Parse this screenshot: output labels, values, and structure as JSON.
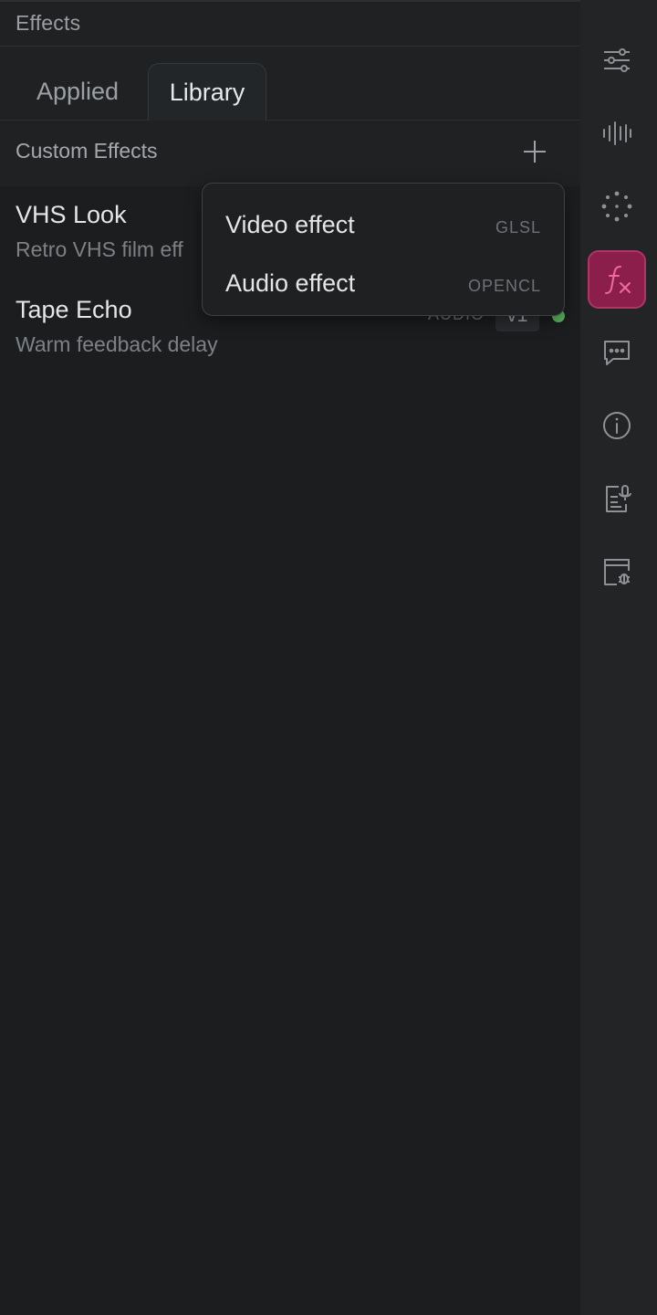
{
  "panel": {
    "title": "Effects"
  },
  "tabs": [
    {
      "label": "Applied",
      "active": false
    },
    {
      "label": "Library",
      "active": true
    }
  ],
  "section": {
    "title": "Custom Effects",
    "add_icon": "plus-icon"
  },
  "effects": [
    {
      "name": "VHS Look",
      "description": "Retro VHS film eff",
      "kind": "",
      "version": "",
      "status_color": ""
    },
    {
      "name": "Tape Echo",
      "description": "Warm feedback delay",
      "kind": "AUDIO",
      "version": "v1",
      "status_color": "#5cb860"
    }
  ],
  "dropdown": {
    "items": [
      {
        "label": "Video effect",
        "hint": "GLSL"
      },
      {
        "label": "Audio effect",
        "hint": "OPENCL"
      }
    ]
  },
  "rail": {
    "items": [
      {
        "icon": "sliders-icon",
        "active": false
      },
      {
        "icon": "waveform-icon",
        "active": false
      },
      {
        "icon": "sparkle-icon",
        "active": false
      },
      {
        "icon": "fx-icon",
        "active": true
      },
      {
        "icon": "chat-icon",
        "active": false
      },
      {
        "icon": "info-icon",
        "active": false
      },
      {
        "icon": "document-mic-icon",
        "active": false
      },
      {
        "icon": "debug-window-icon",
        "active": false
      }
    ],
    "accent_color": "#8b1e4b",
    "accent_icon_color": "#f06aa0"
  }
}
